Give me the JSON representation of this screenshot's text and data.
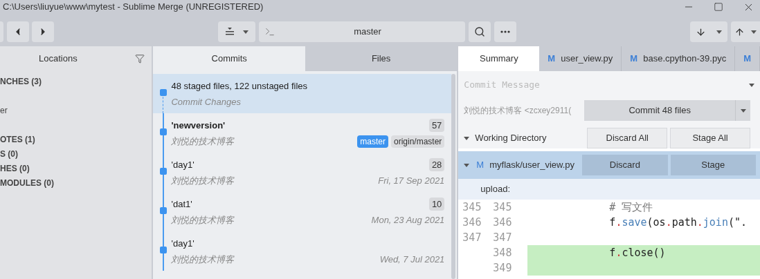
{
  "window": {
    "title": "C:\\Users\\liuyue\\www\\mytest - Sublime Merge (UNREGISTERED)"
  },
  "toolbar": {
    "branch": "master"
  },
  "sidebar": {
    "title": "Locations",
    "items": [
      "NCHES (3)",
      "er",
      "OTES (1)",
      "S (0)",
      "HES (0)",
      "MODULES (0)"
    ]
  },
  "center_tabs": [
    {
      "label": "Commits",
      "selected": true
    },
    {
      "label": "Files",
      "selected": false
    }
  ],
  "commits": [
    {
      "kind": "pending",
      "title": "48 staged files, 122 unstaged files",
      "subtitle": "Commit Changes",
      "selected": true
    },
    {
      "kind": "commit",
      "title": "'newversion'",
      "bold": true,
      "author": "刘悦的技术博客",
      "count": "57",
      "refs": [
        {
          "label": "master",
          "selected": true
        },
        {
          "label": "origin/master",
          "selected": false
        }
      ],
      "selected": false
    },
    {
      "kind": "commit",
      "title": "'day1'",
      "bold": false,
      "author": "刘悦的技术博客",
      "count": "28",
      "date": "Fri, 17 Sep 2021",
      "selected": false
    },
    {
      "kind": "commit",
      "title": "'dat1'",
      "bold": false,
      "author": "刘悦的技术博客",
      "count": "10",
      "date": "Mon, 23 Aug 2021",
      "selected": false
    },
    {
      "kind": "commit",
      "title": "'day1'",
      "bold": false,
      "author": "刘悦的技术博客",
      "date": "Wed, 7 Jul 2021",
      "selected": false
    }
  ],
  "right_tabs": [
    {
      "label": "Summary",
      "selected": true
    },
    {
      "status": "M",
      "label": "user_view.py",
      "selected": false
    },
    {
      "status": "M",
      "label": "base.cpython-39.pyc",
      "selected": false
    },
    {
      "status": "M",
      "selected": false
    }
  ],
  "commit_form": {
    "placeholder": "Commit Message",
    "author": "刘悦的技术博客 <zcxey2911(",
    "commit_button": "Commit 48 files"
  },
  "working_directory": {
    "label": "Working Directory",
    "buttons": [
      "Discard All",
      "Stage All"
    ]
  },
  "file": {
    "status": "M",
    "path": "myflask/user_view.py",
    "buttons": [
      "Discard",
      "Stage"
    ]
  },
  "hunk": {
    "header": "upload:",
    "lines": [
      {
        "kind": "context",
        "old": "345",
        "new": "345",
        "tokens": [
          {
            "kind": "comment",
            "text": "# 写文件"
          }
        ]
      },
      {
        "kind": "context",
        "old": "346",
        "new": "346",
        "tokens": [
          {
            "kind": "name",
            "text": "f"
          },
          {
            "kind": "punct",
            "text": "."
          },
          {
            "kind": "method",
            "text": "save"
          },
          {
            "kind": "name",
            "text": "(os"
          },
          {
            "kind": "punct",
            "text": "."
          },
          {
            "kind": "name",
            "text": "path"
          },
          {
            "kind": "punct",
            "text": "."
          },
          {
            "kind": "method",
            "text": "join"
          },
          {
            "kind": "name",
            "text": "(\"."
          }
        ]
      },
      {
        "kind": "context",
        "old": "347",
        "new": "347"
      },
      {
        "kind": "added",
        "new": "348",
        "tokens": [
          {
            "kind": "name",
            "text": "f"
          },
          {
            "kind": "punct",
            "text": "."
          },
          {
            "kind": "name",
            "text": "close()"
          }
        ]
      },
      {
        "kind": "added",
        "new": "349"
      }
    ]
  }
}
